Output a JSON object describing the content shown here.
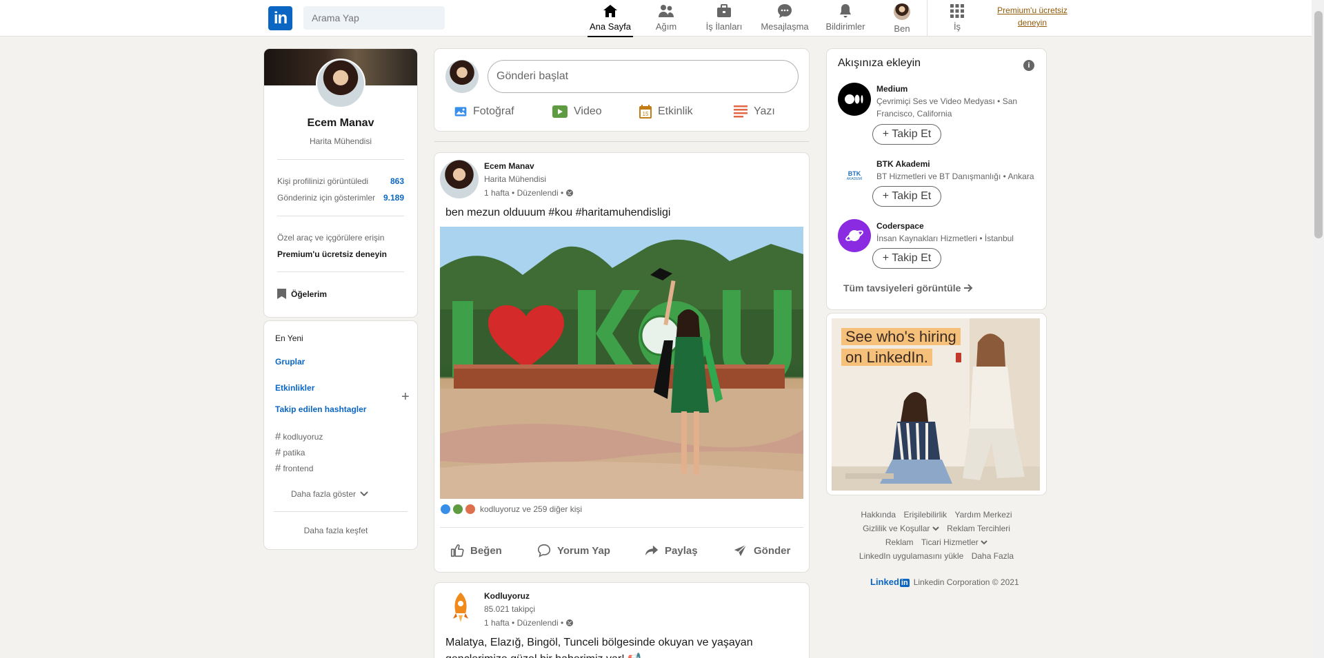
{
  "nav": {
    "search_placeholder": "Arama Yap",
    "items": [
      {
        "label": "Ana Sayfa",
        "icon": "home-icon"
      },
      {
        "label": "Ağım",
        "icon": "network-icon"
      },
      {
        "label": "İş İlanları",
        "icon": "briefcase-icon"
      },
      {
        "label": "Mesajlaşma",
        "icon": "messaging-icon"
      },
      {
        "label": "Bildirimler",
        "icon": "bell-icon"
      },
      {
        "label": "Ben",
        "icon": "avatar"
      },
      {
        "label": "İş",
        "icon": "grid-icon"
      }
    ],
    "premium": "Premium'u ücretsiz deneyin"
  },
  "profile": {
    "name": "Ecem Manav",
    "title": "Harita Mühendisi",
    "views_label": "Kişi profilinizi görüntüledi",
    "views_value": "863",
    "impressions_label": "Gönderiniz için gösterimler",
    "impressions_value": "9.189",
    "tools_label": "Özel araç ve içgörülere erişin",
    "premium_label": "Premium'u ücretsiz deneyin",
    "items_label": "Öğelerim"
  },
  "sidebar": {
    "recent": "En Yeni",
    "groups": "Gruplar",
    "events": "Etkinlikler",
    "hashtags_title": "Takip edilen hashtagler",
    "hashtags": [
      "kodluyoruz",
      "patika",
      "frontend"
    ],
    "show_more": "Daha fazla göster",
    "discover": "Daha fazla keşfet"
  },
  "share": {
    "placeholder": "Gönderi başlat",
    "photo": "Fotoğraf",
    "video": "Video",
    "event": "Etkinlik",
    "article": "Yazı"
  },
  "post": {
    "author": "Ecem Manav",
    "subtitle": "Harita Mühendisi",
    "time": "1 hafta • Düzenlendi •",
    "text": "ben mezun olduuum #kou #haritamuhendisligi",
    "reactions": "kodluyoruz ve 259 diğer kişi",
    "like": "Beğen",
    "comment": "Yorum Yap",
    "share": "Paylaş",
    "send": "Gönder"
  },
  "post2": {
    "author": "Kodluyoruz",
    "subtitle": "85.021 takipçi",
    "time": "1 hafta • Düzenlendi •",
    "text": "Malatya, Elazığ, Bingöl, Tunceli bölgesinde okuyan ve yaşayan",
    "text2": "gençlerimize güzel bir haberimiz var! 📢"
  },
  "feed": {
    "title": "Akışınıza ekleyin",
    "follow": "+ Takip Et",
    "recs": [
      {
        "name": "Medium",
        "desc": "Çevrimiçi Ses ve Video Medyası • San Francisco, California"
      },
      {
        "name": "BTK Akademi",
        "desc": "BT Hizmetleri ve BT Danışmanlığı • Ankara"
      },
      {
        "name": "Coderspace",
        "desc": "İnsan Kaynakları Hizmetleri • İstanbul"
      }
    ],
    "all": "Tüm tavsiyeleri görüntüle"
  },
  "ad": {
    "line1": "See who's hiring",
    "line2": "on LinkedIn."
  },
  "footer": {
    "links1": [
      "Hakkında",
      "Erişilebilirlik",
      "Yardım Merkezi"
    ],
    "privacy": "Gizlilik ve Koşullar",
    "ad_prefs": "Reklam Tercihleri",
    "ads": "Reklam",
    "business": "Ticari Hizmetler",
    "app": "LinkedIn uygulamasını yükle",
    "more": "Daha Fazla",
    "copyright": "Linkedin Corporation © 2021"
  },
  "colors": {
    "brand": "#0a66c2",
    "premium": "#915907",
    "background": "#f3f2ef"
  }
}
